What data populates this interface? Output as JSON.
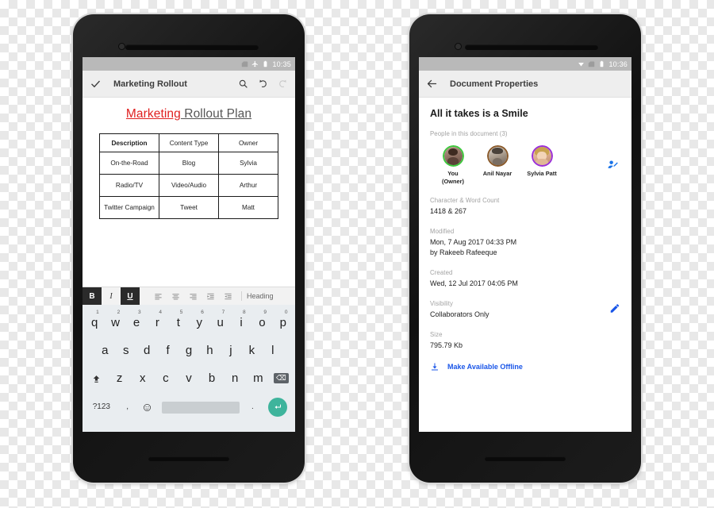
{
  "left_phone": {
    "statusbar": {
      "time": "10:35",
      "icons": [
        "sim-icon",
        "airplane-mode-icon",
        "battery-icon"
      ]
    },
    "appbar": {
      "confirm_icon": "check-icon",
      "title": "Marketing Rollout",
      "actions": [
        "search-icon",
        "undo-icon",
        "redo-icon"
      ]
    },
    "document": {
      "title_part_red": "Marketing",
      "title_part_grey": " Rollout Plan",
      "table": {
        "headers": [
          "Description",
          "Content Type",
          "Owner"
        ],
        "rows": [
          {
            "description": "On-the-Road",
            "content_type": "Blog",
            "owner": "Sylvia",
            "owner_color": "#1a73e8"
          },
          {
            "description": "Radio/TV",
            "content_type": "Video/Audio",
            "owner": "Arthur",
            "owner_color": "#e02020"
          },
          {
            "description": "Twitter Campaign",
            "content_type": "Tweet",
            "owner": "Matt",
            "owner_color": "#0a9d4f"
          }
        ]
      }
    },
    "format_toolbar": {
      "bold": "B",
      "italic": "I",
      "underline": "U",
      "icons": [
        "align-left-icon",
        "align-center-icon",
        "align-right-icon",
        "indent-decrease-icon",
        "indent-increase-icon"
      ],
      "style_label": "Heading"
    },
    "keyboard": {
      "row1": [
        {
          "key": "q",
          "num": "1"
        },
        {
          "key": "w",
          "num": "2"
        },
        {
          "key": "e",
          "num": "3"
        },
        {
          "key": "r",
          "num": "4"
        },
        {
          "key": "t",
          "num": "5"
        },
        {
          "key": "y",
          "num": "6"
        },
        {
          "key": "u",
          "num": "7"
        },
        {
          "key": "i",
          "num": "8"
        },
        {
          "key": "o",
          "num": "9"
        },
        {
          "key": "p",
          "num": "0"
        }
      ],
      "row2": [
        "a",
        "s",
        "d",
        "f",
        "g",
        "h",
        "j",
        "k",
        "l"
      ],
      "row3": [
        "z",
        "x",
        "c",
        "v",
        "b",
        "n",
        "m"
      ],
      "shift_icon": "shift-icon",
      "backspace_icon": "backspace-icon",
      "symbols_key": "?123",
      "comma_key": ",",
      "emoji_icon": "emoji-icon",
      "space_key": "",
      "period_key": ".",
      "enter_icon": "enter-icon"
    },
    "navbar": {
      "back": "back-triangle-down-icon",
      "home": "home-circle-icon",
      "recents": "recents-square-icon"
    }
  },
  "right_phone": {
    "statusbar": {
      "time": "10:36",
      "icons": [
        "wifi-icon",
        "sim-icon",
        "battery-icon"
      ]
    },
    "appbar": {
      "back_icon": "arrow-back-icon",
      "title": "Document Properties"
    },
    "properties": {
      "doc_title": "All it takes is a Smile",
      "people_label": "People in this document (3)",
      "people": [
        {
          "name": "You\n(Owner)",
          "name_line1": "You",
          "name_line2": "(Owner)",
          "ring_color": "#3ec93e"
        },
        {
          "name": "Anil Nayar",
          "name_line1": "Anil Nayar",
          "name_line2": "",
          "ring_color": "#8a5a2b"
        },
        {
          "name": "Sylvia Patt",
          "name_line1": "Sylvia Patt",
          "name_line2": "",
          "ring_color": "#9b30d9"
        }
      ],
      "add_person_icon": "add-person-icon",
      "fields": [
        {
          "label": "Character & Word Count",
          "value": "1418 & 267",
          "value2": ""
        },
        {
          "label": "Modified",
          "value": "Mon, 7 Aug 2017 04:33 PM",
          "value2": "by Rakeeb Rafeeque"
        },
        {
          "label": "Created",
          "value": "Wed, 12 Jul 2017 04:05 PM",
          "value2": ""
        },
        {
          "label": "Visibility",
          "value": "Collaborators Only",
          "value2": "",
          "edit_icon": "pencil-edit-icon"
        },
        {
          "label": "Size",
          "value": "795.79 Kb",
          "value2": ""
        }
      ],
      "offline_icon": "download-offline-icon",
      "offline_label": "Make Available Offline",
      "accent_color": "#1a56e8"
    },
    "navbar": {
      "back": "back-triangle-left-icon",
      "home": "home-circle-icon",
      "recents": "recents-square-icon"
    }
  }
}
